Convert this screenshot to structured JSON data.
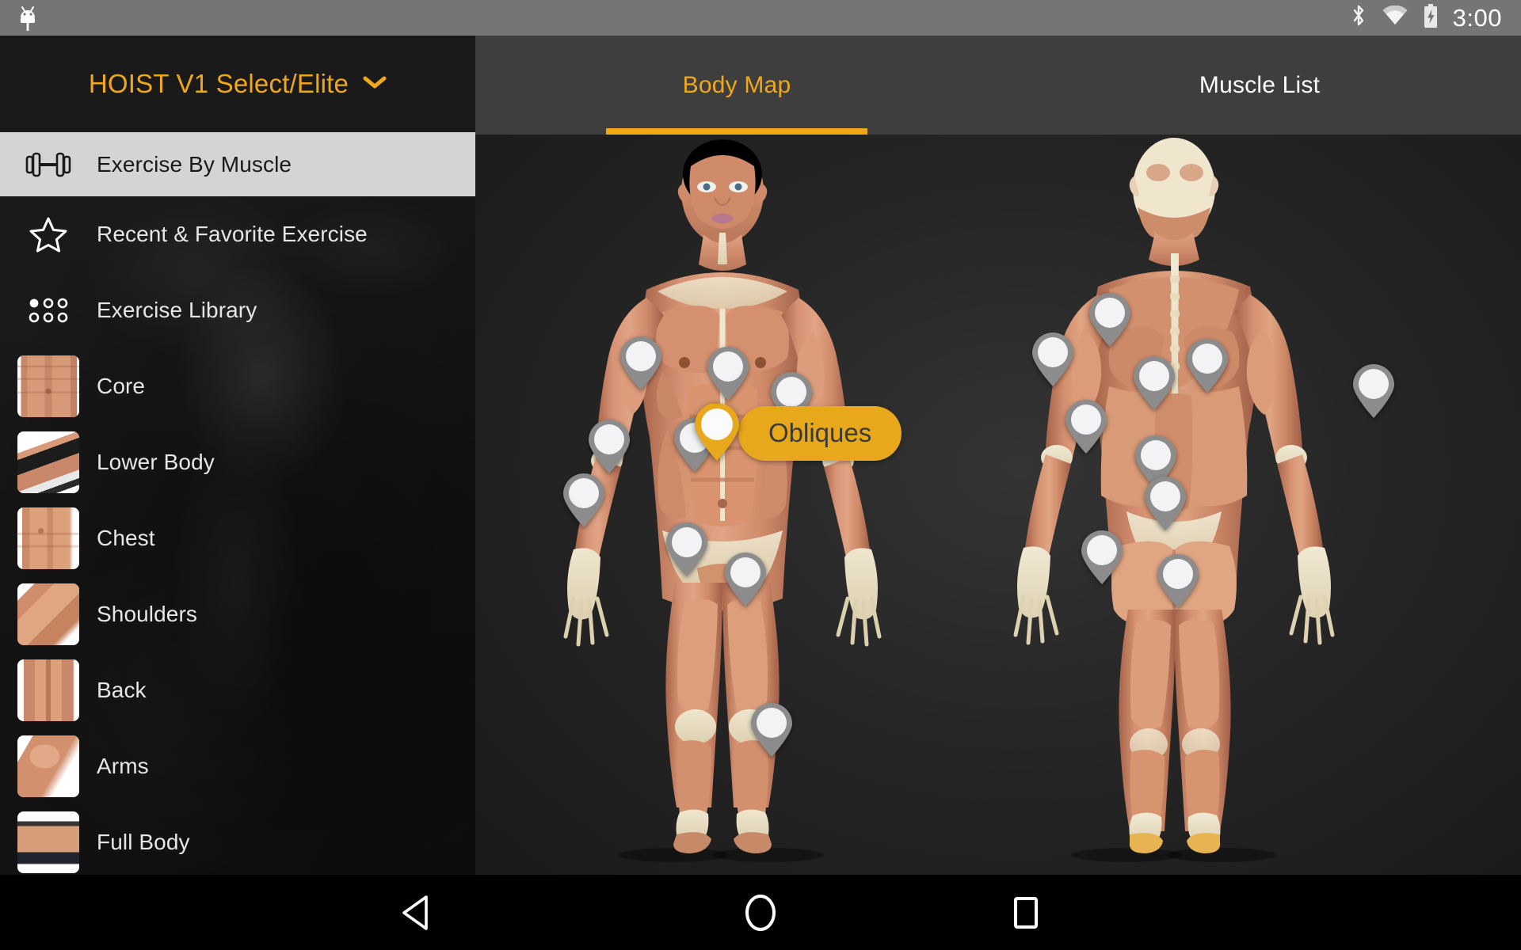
{
  "statusbar": {
    "time": "3:00",
    "icons": [
      "android-head-icon",
      "bluetooth-icon",
      "wifi-icon",
      "battery-charging-icon"
    ]
  },
  "sidebar": {
    "title": "HOIST V1 Select/Elite",
    "title_caret": "chevron-down-icon",
    "nav_items": [
      {
        "label": "Exercise By Muscle",
        "icon": "dumbbell-icon",
        "selected": true
      },
      {
        "label": "Recent & Favorite Exercise",
        "icon": "star-outline-icon",
        "selected": false
      },
      {
        "label": "Exercise Library",
        "icon": "dot-grid-icon",
        "selected": false
      }
    ],
    "muscle_groups": [
      {
        "label": "Core",
        "thumb": "core-thumbnail"
      },
      {
        "label": "Lower Body",
        "thumb": "lower-body-thumbnail"
      },
      {
        "label": "Chest",
        "thumb": "chest-thumbnail"
      },
      {
        "label": "Shoulders",
        "thumb": "shoulders-thumbnail"
      },
      {
        "label": "Back",
        "thumb": "back-thumbnail"
      },
      {
        "label": "Arms",
        "thumb": "arms-thumbnail"
      },
      {
        "label": "Full Body",
        "thumb": "full-body-thumbnail"
      }
    ]
  },
  "main": {
    "tabs": [
      {
        "label": "Body Map",
        "active": true
      },
      {
        "label": "Muscle List",
        "active": false
      }
    ],
    "selected_muscle": {
      "label": "Obliques"
    },
    "front_view_pins": 9,
    "back_view_pins": 9
  },
  "navbar": {
    "back": "back-triangle-icon",
    "home": "home-circle-icon",
    "recents": "recents-square-icon"
  },
  "colors": {
    "accent": "#f0a818",
    "pill": "#e8a81c",
    "sidebar_bg": "#1c1c1c",
    "selected_item_bg": "#d4d4d4",
    "tabbar_bg": "#3e3e3e",
    "statusbar_bg": "#757575",
    "navbar_bg": "#000000",
    "pin_grey": "#8c8c8c"
  }
}
